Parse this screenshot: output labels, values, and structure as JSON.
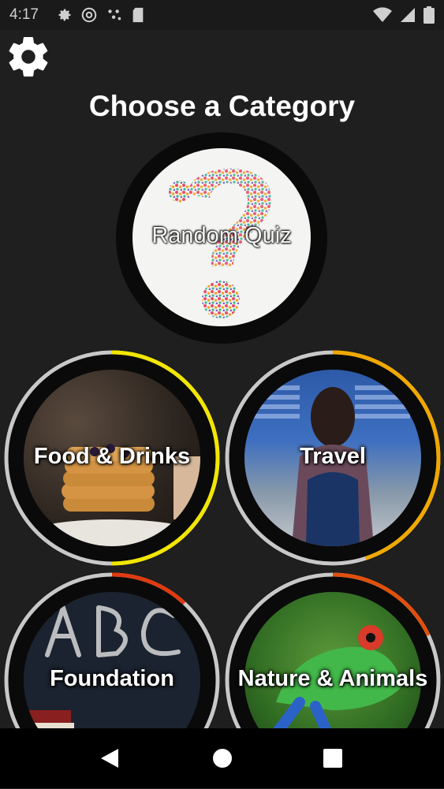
{
  "status_bar": {
    "time": "4:17",
    "left_icons": [
      "gear-icon",
      "at-icon",
      "dots-icon",
      "sd-card-icon"
    ],
    "right_icons": [
      "wifi-icon",
      "signal-icon",
      "battery-icon"
    ]
  },
  "header": {
    "title": "Choose a Category",
    "settings_icon": "gear-icon"
  },
  "categories": [
    {
      "label": "Random Quiz",
      "progress": 0
    },
    {
      "label": "Food & Drinks",
      "progress": 0.5,
      "accent": "#f2e600"
    },
    {
      "label": "Travel",
      "progress": 0.45,
      "accent": "#f0a800"
    },
    {
      "label": "Foundation",
      "progress": 0.12,
      "accent": "#e03a10"
    },
    {
      "label": "Nature & Animals",
      "progress": 0.18,
      "accent": "#e0500c"
    }
  ],
  "nav_bar": {
    "back": "back-icon",
    "home": "home-icon",
    "recents": "recents-icon"
  },
  "colors": {
    "background": "#1f1f1f",
    "ring_track": "#c8c8c8"
  }
}
